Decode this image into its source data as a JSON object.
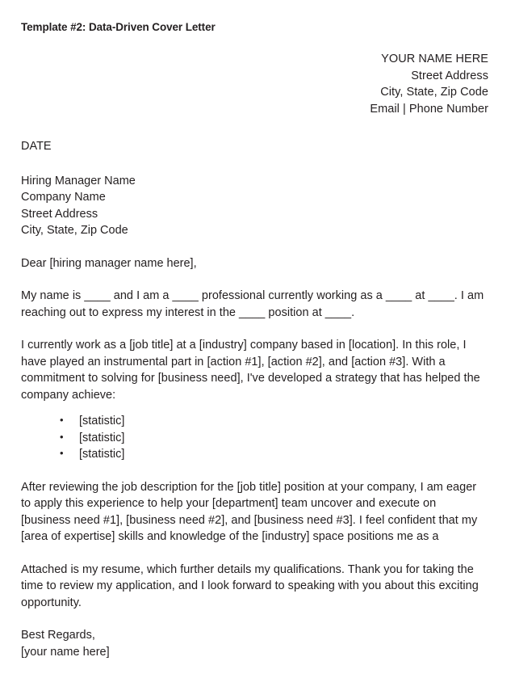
{
  "document": {
    "title": "Template #2: Data-Driven Cover Letter",
    "sender": {
      "name": "YOUR NAME HERE",
      "street": "Street Address",
      "city_state_zip": "City, State, Zip Code",
      "contact": "Email | Phone Number"
    },
    "date": "DATE",
    "recipient": {
      "manager": "Hiring Manager Name",
      "company": "Company Name",
      "street": "Street Address",
      "city_state_zip": "City, State, Zip Code"
    },
    "salutation": "Dear [hiring manager name here],",
    "paragraphs": {
      "intro": "My name is ____ and I am a ____ professional currently working as a ____ at ____. I am reaching out to express my interest in the ____ position at ____.",
      "experience": "I currently work as a [job title] at a [industry] company based in [location]. In this role, I have played an instrumental part in [action #1], [action #2], and [action #3]. With a commitment to solving for [business need], I've developed a strategy that has helped the company achieve:",
      "fit": "After reviewing the job description for the [job title] position at your company, I am eager to apply this experience to help your [department] team uncover and execute on [business need #1], [business need #2], and [business need #3].  I feel confident that my [area of expertise] skills and knowledge of the [industry] space positions me as a",
      "closing": "Attached is my resume, which further details my qualifications. Thank you for taking the time to review my application, and I look forward to speaking with you about this exciting opportunity."
    },
    "achievements": [
      "[statistic]",
      "[statistic]",
      "[statistic]"
    ],
    "signoff": {
      "regards": "Best Regards,",
      "name": "[your name here]"
    },
    "colors": {
      "text": "#231f20",
      "background": "#ffffff"
    }
  }
}
